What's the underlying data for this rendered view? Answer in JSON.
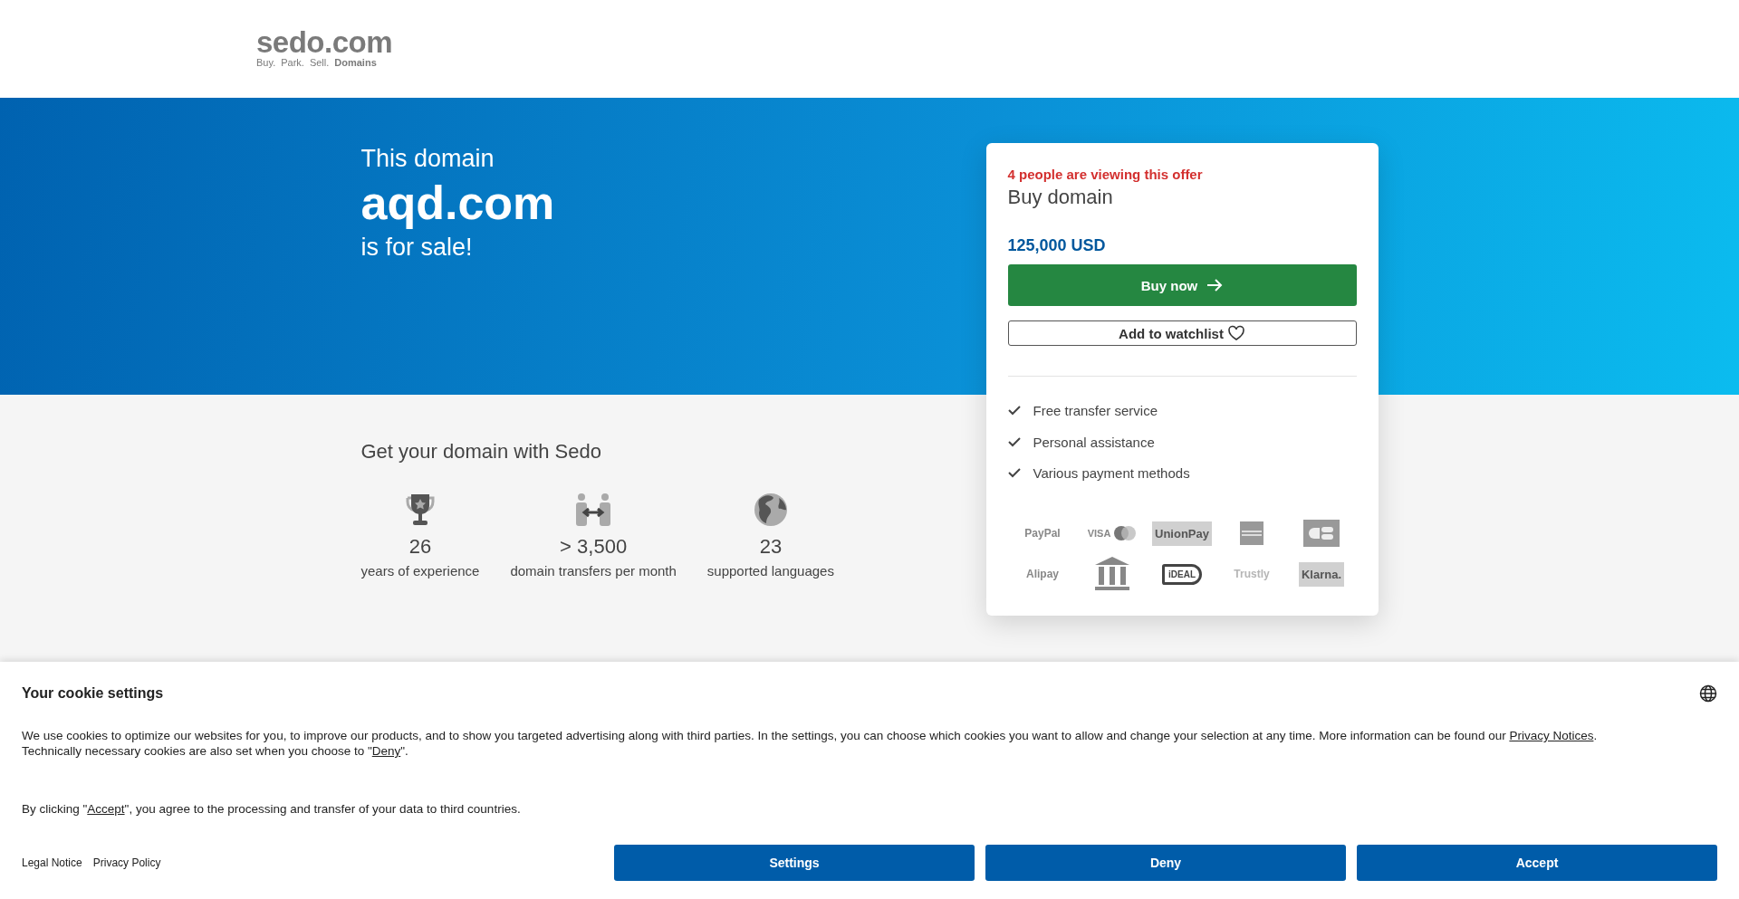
{
  "header": {
    "logo": "sedo.com",
    "tagline_parts": [
      {
        "text": "Buy.",
        "bold": false
      },
      {
        "text": "Park.",
        "bold": false
      },
      {
        "text": "Sell.",
        "bold": false
      },
      {
        "text": "Domains",
        "bold": true
      }
    ]
  },
  "hero": {
    "intro": "This domain",
    "domain": "aqd.com",
    "outro": "is for sale!"
  },
  "offer": {
    "viewers": "4 people are viewing this offer",
    "title": "Buy domain",
    "price": "125,000 USD",
    "buy_button": "Buy now",
    "watch_button": "Add to watchlist",
    "features": [
      "Free transfer service",
      "Personal assistance",
      "Various payment methods"
    ],
    "payment_methods": [
      {
        "kind": "wordmark",
        "label": "PayPal"
      },
      {
        "kind": "cards",
        "label": "VISA"
      },
      {
        "kind": "badge",
        "label": "UnionPay"
      },
      {
        "kind": "amex"
      },
      {
        "kind": "cb"
      },
      {
        "kind": "wordmark",
        "label": "Alipay"
      },
      {
        "kind": "bank"
      },
      {
        "kind": "ideal",
        "label": "iDEAL"
      },
      {
        "kind": "faint",
        "label": "Trustly"
      },
      {
        "kind": "badge",
        "label": "Klarna."
      }
    ]
  },
  "benefits": {
    "title": "Get your domain with Sedo",
    "items": [
      {
        "kind": "trophy",
        "value": "26",
        "label": "years of experience"
      },
      {
        "kind": "transfer",
        "value": "> 3,500",
        "label": "domain transfers per month"
      },
      {
        "kind": "globe",
        "value": "23",
        "label": "supported languages"
      }
    ]
  },
  "cookie_banner": {
    "title": "Your cookie settings",
    "paragraph": [
      {
        "text": "We use cookies to optimize our websites for you, to improve our products, and to show you targeted advertising along with third parties. In the settings, you can choose which cookies you want to allow and change your selection at any time. More information can be found our ",
        "link": false
      },
      {
        "text": "Privacy Notices",
        "link": true
      },
      {
        "text": ". Technically necessary cookies are also set when you choose to \"",
        "link": false
      },
      {
        "text": "Deny",
        "link": true
      },
      {
        "text": "\".",
        "link": false
      }
    ],
    "consent": [
      {
        "text": "By clicking \"",
        "link": false
      },
      {
        "text": "Accept",
        "link": true
      },
      {
        "text": "\", you agree to the processing and transfer of your data to third countries.",
        "link": false
      }
    ],
    "links": [
      "Legal Notice",
      "Privacy Policy"
    ],
    "buttons": [
      "Settings",
      "Deny",
      "Accept"
    ]
  }
}
